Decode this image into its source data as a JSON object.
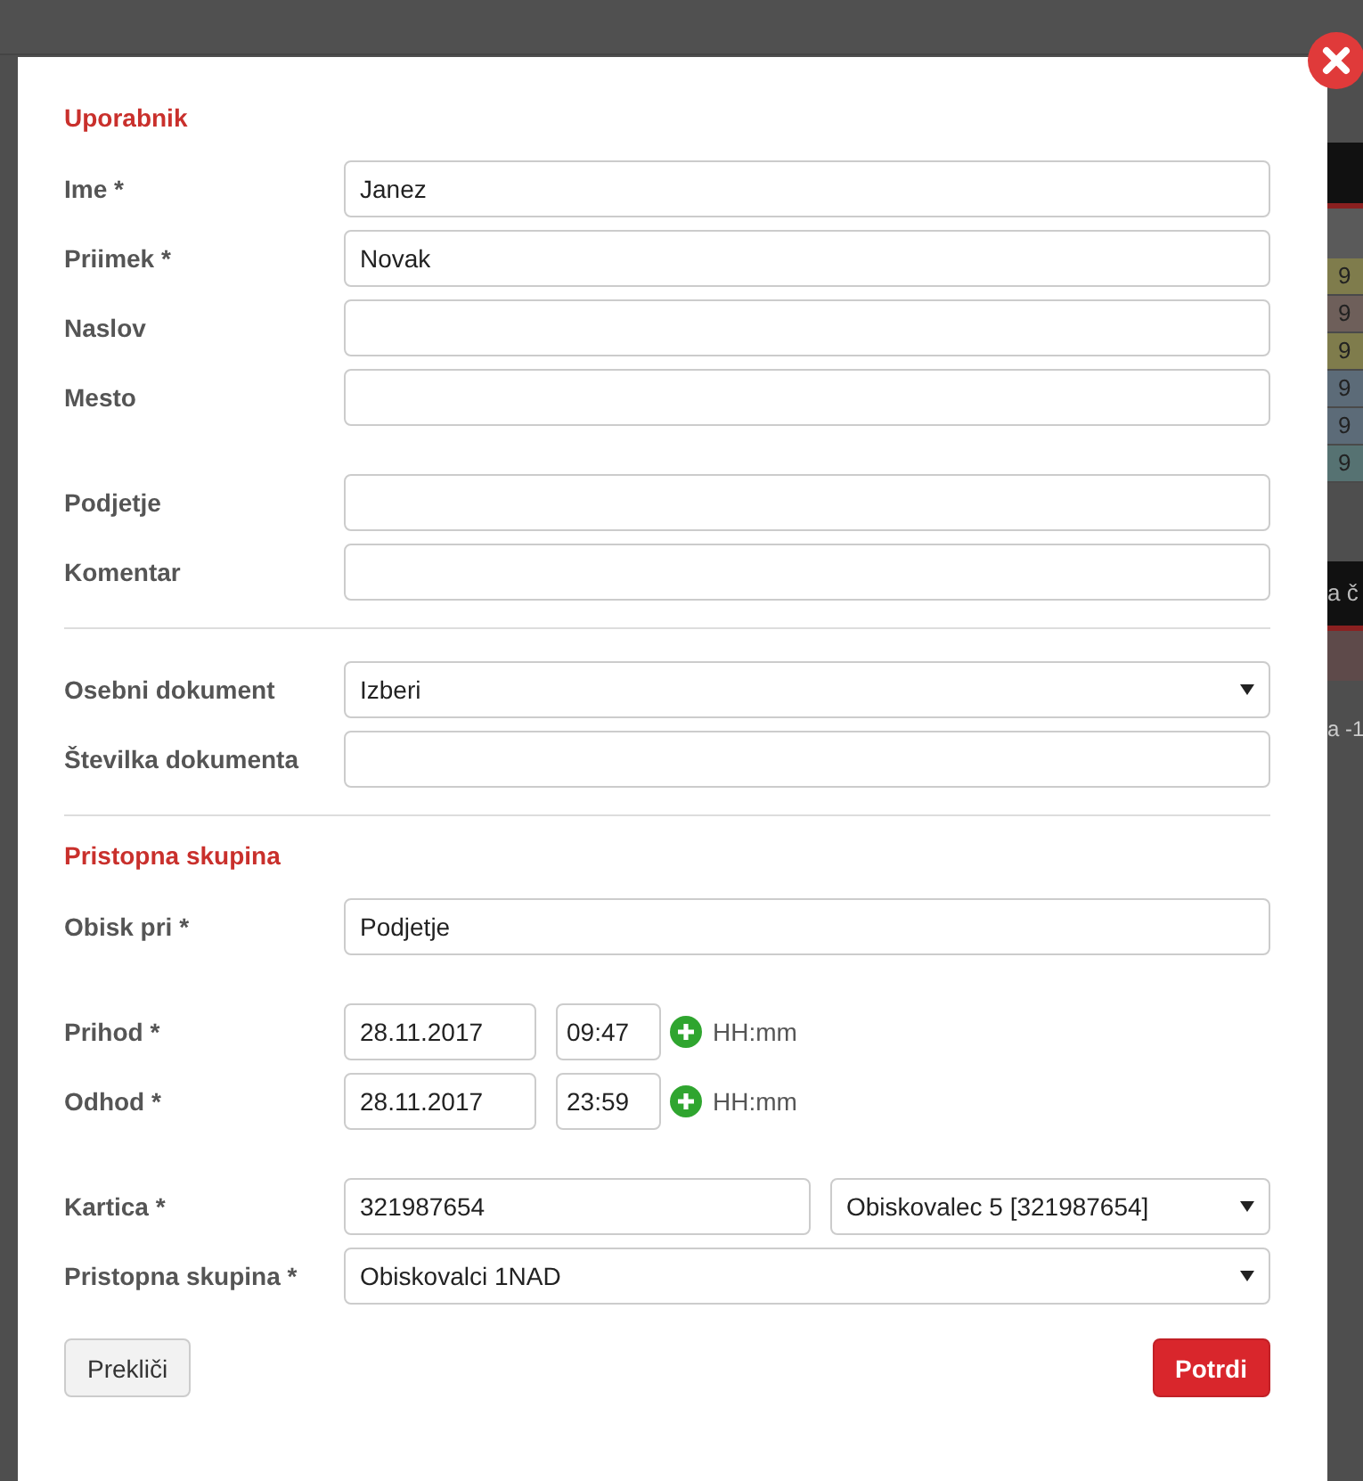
{
  "backdrop": {
    "cells": [
      {
        "text": "9",
        "color": "#7f7c4c"
      },
      {
        "text": "9",
        "color": "#6e5f5a"
      },
      {
        "text": "9",
        "color": "#7f7c4c"
      },
      {
        "text": "9",
        "color": "#5c6b78"
      },
      {
        "text": "9",
        "color": "#5c6b78"
      },
      {
        "text": "9",
        "color": "#567272"
      }
    ],
    "header_2": "a č",
    "footer_text": "a -1"
  },
  "dialog": {
    "sections": [
      {
        "title": "Uporabnik",
        "groups": [
          [
            {
              "kind": "text",
              "label": "Ime *",
              "value": "Janez"
            },
            {
              "kind": "text",
              "label": "Priimek *",
              "value": "Novak"
            },
            {
              "kind": "text",
              "label": "Naslov"
            },
            {
              "kind": "text",
              "label": "Mesto"
            }
          ],
          [
            {
              "kind": "text",
              "label": "Podjetje"
            },
            {
              "kind": "text",
              "label": "Komentar"
            }
          ]
        ]
      },
      {
        "groups": [
          [
            {
              "kind": "select",
              "label": "Osebni dokument",
              "value": "Izberi"
            },
            {
              "kind": "text",
              "label": "Številka dokumenta"
            }
          ]
        ]
      },
      {
        "title": "Pristopna skupina",
        "groups": [
          [
            {
              "kind": "text",
              "label": "Obisk pri *",
              "value": "Podjetje"
            }
          ],
          [
            {
              "kind": "datetime",
              "label": "Prihod *",
              "date": "28.11.2017",
              "time": "09:47",
              "hint": "HH:mm"
            },
            {
              "kind": "datetime",
              "label": "Odhod *",
              "date": "28.11.2017",
              "time": "23:59",
              "hint": "HH:mm"
            }
          ],
          [
            {
              "kind": "card",
              "label": "Kartica *",
              "value": "321987654",
              "option": "Obiskovalec 5 [321987654]"
            },
            {
              "kind": "select",
              "label": "Pristopna skupina *",
              "value": "Obiskovalci 1NAD"
            }
          ]
        ]
      }
    ],
    "cancel": "Prekliči",
    "confirm": "Potrdi"
  }
}
